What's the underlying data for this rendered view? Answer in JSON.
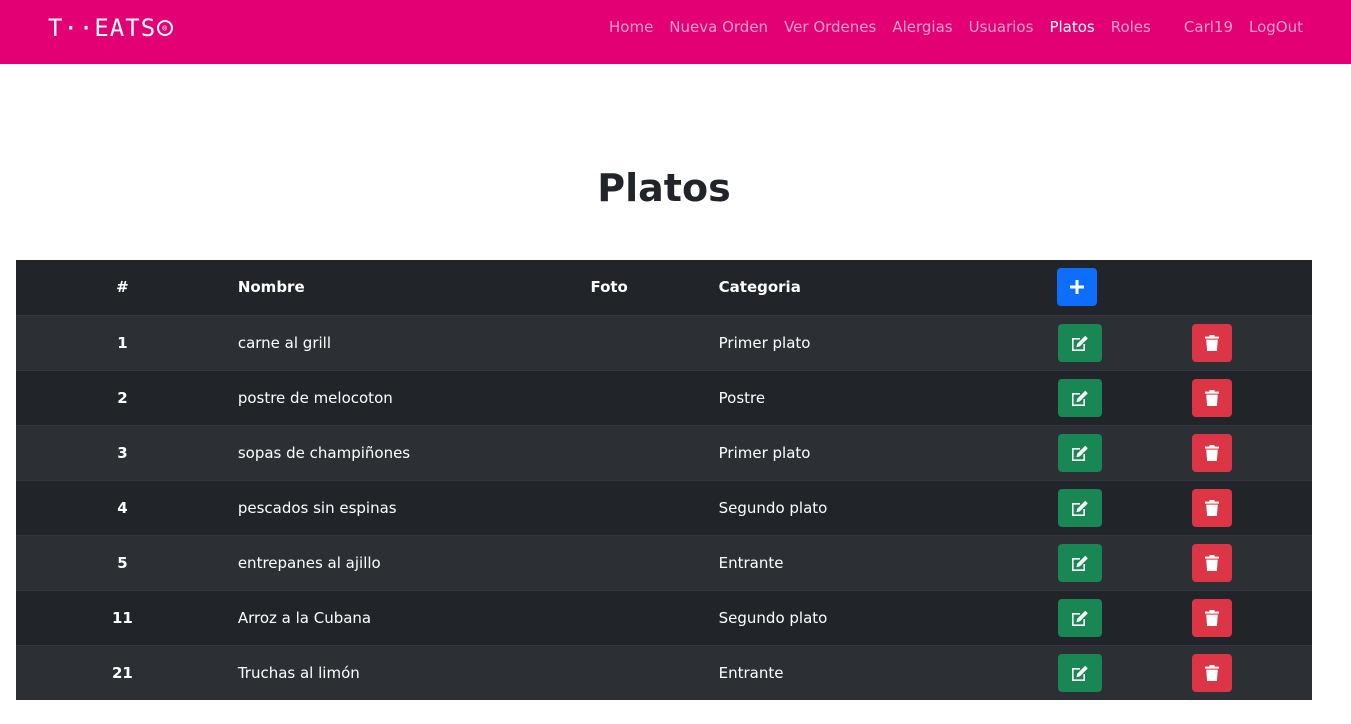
{
  "nav": {
    "brand": "T··EATS",
    "brand_mark": "®",
    "links": [
      "Home",
      "Nueva Orden",
      "Ver Ordenes",
      "Alergias",
      "Usuarios",
      "Platos",
      "Roles"
    ],
    "active": "Platos",
    "user": "Carl19",
    "logout": "LogOut"
  },
  "page": {
    "title": "Platos"
  },
  "table": {
    "headers": {
      "num": "#",
      "name": "Nombre",
      "photo": "Foto",
      "category": "Categoria"
    },
    "rows": [
      {
        "id": "1",
        "name": "carne al grill",
        "category": "Primer plato"
      },
      {
        "id": "2",
        "name": "postre de melocoton",
        "category": "Postre"
      },
      {
        "id": "3",
        "name": "sopas de champiñones",
        "category": "Primer plato"
      },
      {
        "id": "4",
        "name": "pescados sin espinas",
        "category": "Segundo plato"
      },
      {
        "id": "5",
        "name": "entrepanes al ajillo",
        "category": "Entrante"
      },
      {
        "id": "11",
        "name": "Arroz a la Cubana",
        "category": "Segundo plato"
      },
      {
        "id": "21",
        "name": "Truchas al limón",
        "category": "Entrante"
      }
    ]
  },
  "icons": {
    "add": "plus-icon",
    "edit": "edit-icon",
    "delete": "trash-icon"
  },
  "colors": {
    "navbar": "#e20074",
    "add": "#0d6efd",
    "edit": "#198754",
    "delete": "#dc3545",
    "table": "#212529"
  }
}
